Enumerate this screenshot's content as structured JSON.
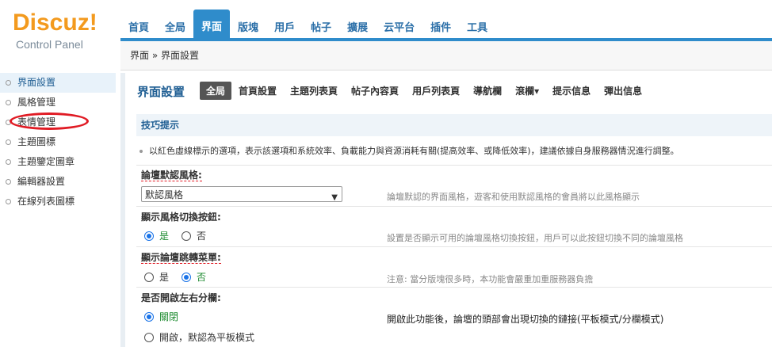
{
  "logo": {
    "brand": "Discuz!",
    "sub": "Control Panel"
  },
  "topnav": [
    "首頁",
    "全局",
    "界面",
    "版塊",
    "用戶",
    "帖子",
    "擴展",
    "云平台",
    "插件",
    "工具"
  ],
  "breadcrumb": "界面 » 界面設置",
  "sidebar": [
    "界面設置",
    "風格管理",
    "表情管理",
    "主題圖標",
    "主題鑒定圖章",
    "編輯器設置",
    "在線列表圖標"
  ],
  "main": {
    "title": "界面設置",
    "tabs": [
      "全局",
      "首頁設置",
      "主題列表頁",
      "帖子內容頁",
      "用戶列表頁",
      "導航欄",
      "滾欄▾",
      "提示信息",
      "彈出信息"
    ],
    "tip_head": "技巧提示",
    "tip_text": "以紅色虛線標示的選項，表示該選項和系統效率、負載能力與資源消耗有關(提高效率、或降低效率)，建議依據自身服務器情況進行調整。",
    "s1_label": "論壇默認風格:",
    "s1_value": "默認風格",
    "s1_hint": "論壇默認的界面風格，遊客和使用默認風格的會員將以此風格顯示",
    "s2_label": "顯示風格切換按鈕:",
    "s2_yes": "是",
    "s2_no": "否",
    "s2_hint": "設置是否顯示可用的論壇風格切換按鈕，用戶可以此按鈕切換不同的論壇風格",
    "s3_label": "顯示論壇跳轉菜單:",
    "s3_yes": "是",
    "s3_no": "否",
    "s3_hint": "注意: 當分版塊很多時，本功能會嚴重加重服務器負擔",
    "s4_label": "是否開啟左右分欄:",
    "s4_opt1": "關閉",
    "s4_opt2": "開啟，默認為平板模式",
    "s4_hint": "開啟此功能後，論壇的頭部會出現切換的鏈接(平板模式/分欄模式)"
  }
}
